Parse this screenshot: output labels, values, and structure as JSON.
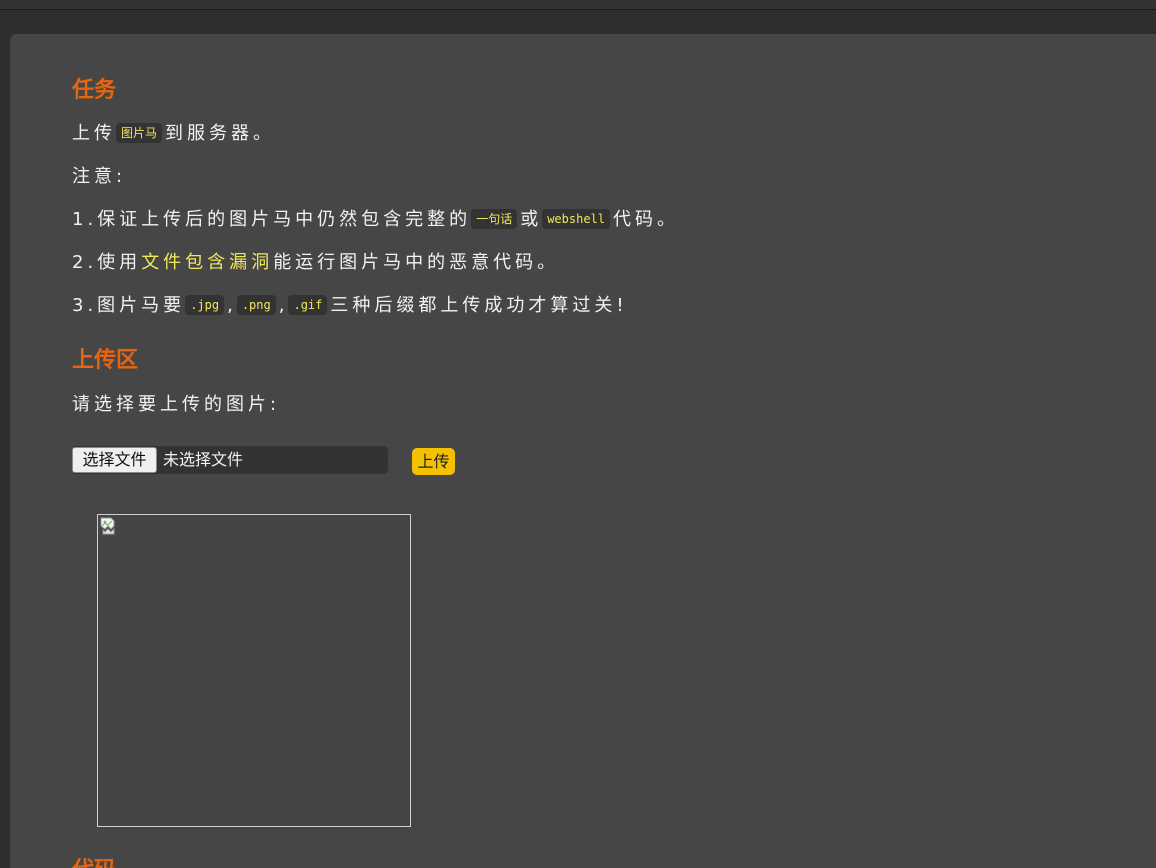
{
  "task": {
    "heading": "任务",
    "line1": {
      "before": "上传",
      "code": "图片马",
      "after": "到服务器。"
    },
    "note": "注意:",
    "item1": {
      "before": "1.保证上传后的图片马中仍然包含完整的",
      "code1": "一句话",
      "mid": "或",
      "code2": "webshell",
      "after": "代码。"
    },
    "item2": {
      "before": "2.使用",
      "highlight": "文件包含漏洞",
      "after": "能运行图片马中的恶意代码。"
    },
    "item3": {
      "before": "3.图片马要",
      "code1": ".jpg",
      "sep1": ",",
      "code2": ".png",
      "sep2": ",",
      "code3": ".gif",
      "after": "三种后缀都上传成功才算过关!"
    }
  },
  "upload": {
    "heading": "上传区",
    "prompt": "请选择要上传的图片:",
    "choose_label": "选择文件",
    "no_file_text": "未选择文件",
    "submit_label": "上传"
  },
  "code_section": {
    "heading": "代码"
  },
  "colors": {
    "heading": "#e8650f",
    "highlight": "#f2e85a",
    "upload_button": "#f5c000"
  }
}
